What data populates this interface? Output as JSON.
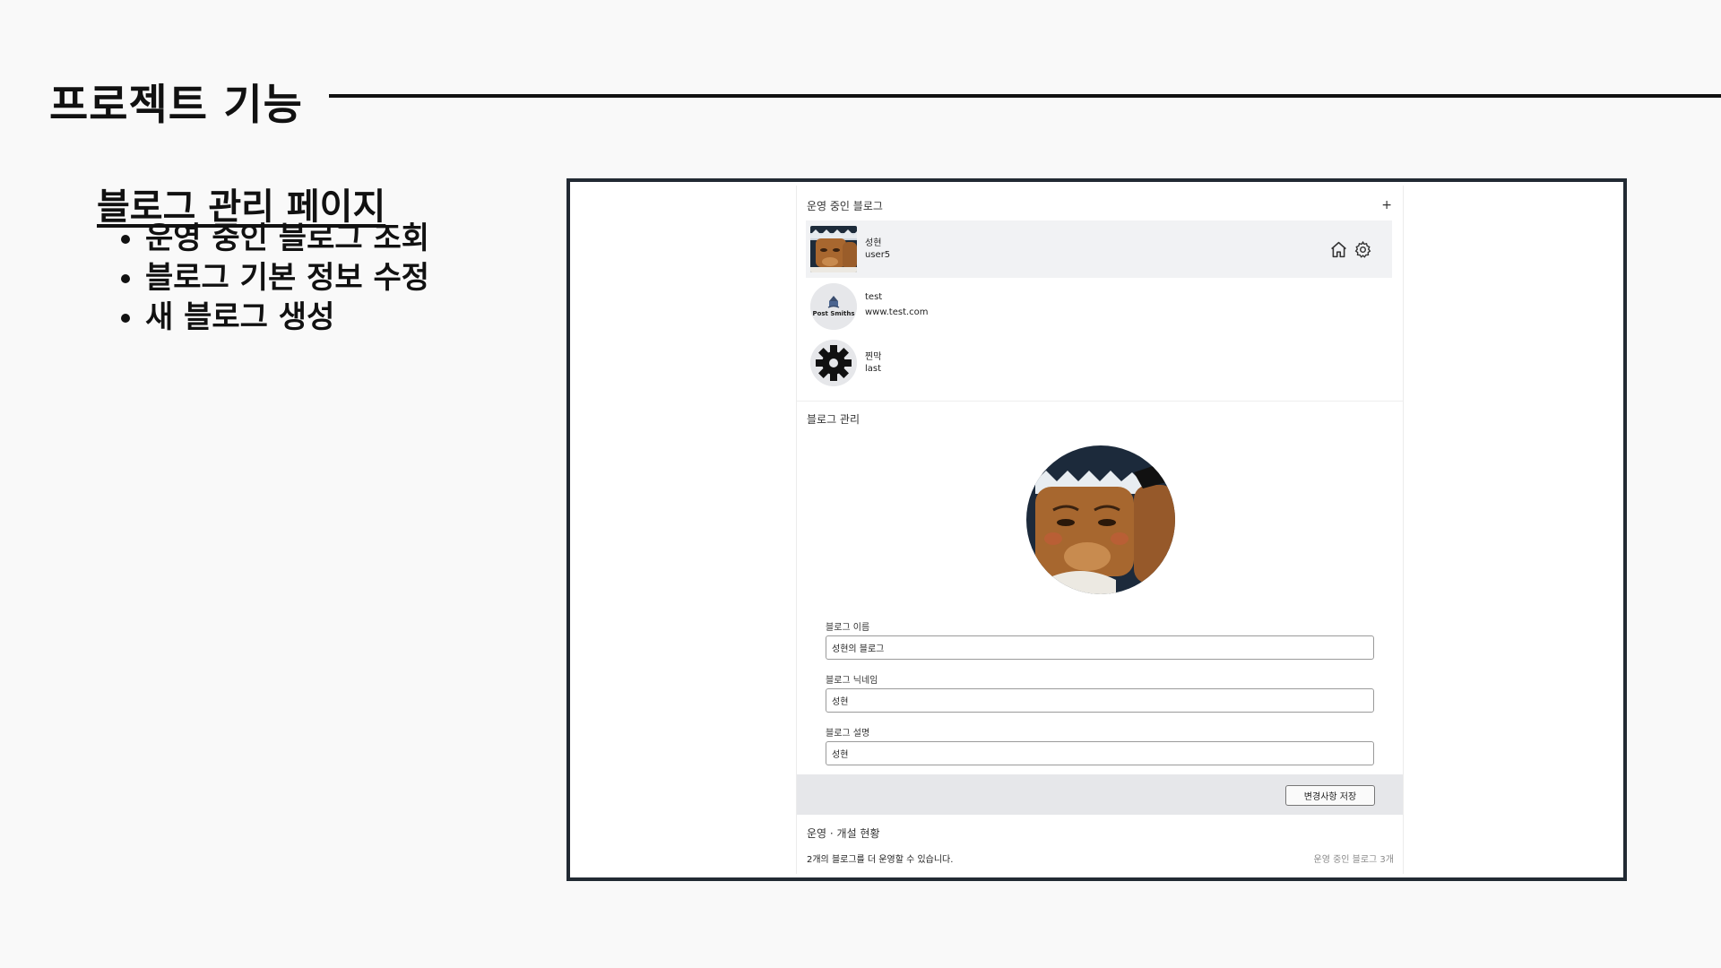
{
  "slide": {
    "title": "프로젝트 기능",
    "section_heading": "블로그 관리 페이지",
    "bullets": [
      "운영 중인 블로그 조회",
      "블로그 기본 정보 수정",
      "새 블로그 생성"
    ]
  },
  "app": {
    "running_blogs": {
      "heading": "운영 중인 블로그",
      "add_label": "+",
      "items": [
        {
          "name": "성현",
          "sub": "user5",
          "avatar": "cartoon-character-avatar",
          "selected": true
        },
        {
          "name": "test",
          "sub": "www.test.com",
          "avatar": "post-smiths-logo",
          "logo_text": "Post Smiths"
        },
        {
          "name": "찐막",
          "sub": "last",
          "avatar": "gear-avatar"
        }
      ]
    },
    "management": {
      "heading": "블로그 관리",
      "fields": [
        {
          "label": "블로그 이름",
          "value": "성현의 블로그"
        },
        {
          "label": "블로그 닉네임",
          "value": "성현"
        },
        {
          "label": "블로그 설명",
          "value": "성현"
        }
      ],
      "save_label": "변경사항 저장"
    },
    "status": {
      "heading": "운영 · 개설 현황",
      "text": "2개의 블로그를 더 운영할 수 있습니다.",
      "count": "운영 중인 블로그 3개"
    }
  },
  "colors": {
    "background": "#f9f9f9",
    "frame_border": "#222a33",
    "selected_row": "#f1f2f4",
    "save_bar": "#e6e7ea"
  }
}
